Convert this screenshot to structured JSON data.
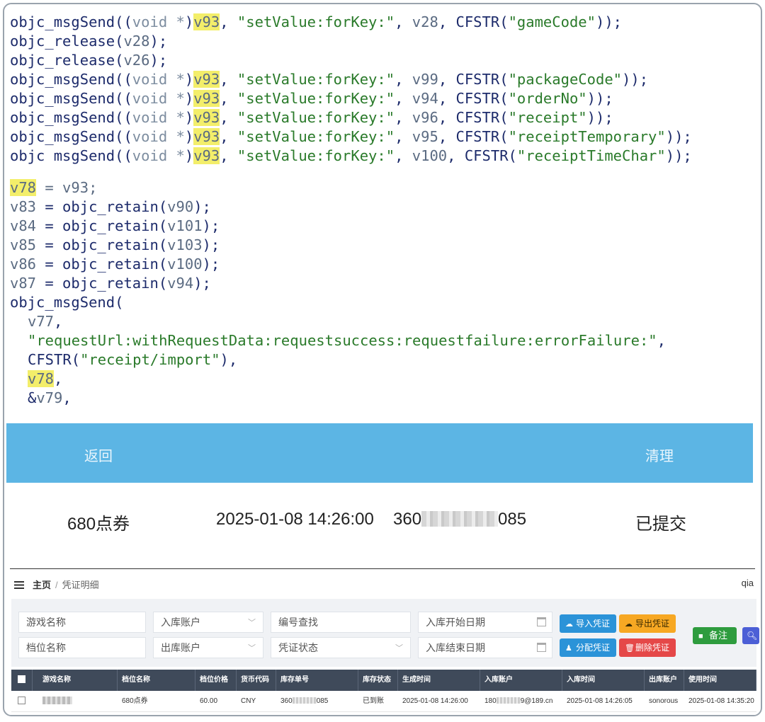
{
  "code": {
    "lines": [
      {
        "prefix": "objc_msgSend((",
        "cast": "void *",
        "mid": ")",
        "hl": "v93",
        "rest1": ", ",
        "str": "\"setValue:forKey:\"",
        "rest2": ", ",
        "var": "v28",
        "rest3": ", CFSTR(",
        "str2": "\"gameCode\"",
        "rest4": "));"
      },
      {
        "prefix": "objc_release(",
        "var": "v28",
        "rest": ");"
      },
      {
        "prefix": "objc_release(",
        "var": "v26",
        "rest": ");"
      },
      {
        "prefix": "objc_msgSend((",
        "cast": "void *",
        "mid": ")",
        "hl": "v93",
        "rest1": ", ",
        "str": "\"setValue:forKey:\"",
        "rest2": ", ",
        "var": "v99",
        "rest3": ", CFSTR(",
        "str2": "\"packageCode\"",
        "rest4": "));"
      },
      {
        "prefix": "objc_msgSend((",
        "cast": "void *",
        "mid": ")",
        "hl": "v93",
        "rest1": ", ",
        "str": "\"setValue:forKey:\"",
        "rest2": ", ",
        "var": "v94",
        "rest3": ", CFSTR(",
        "str2": "\"orderNo\"",
        "rest4": "));"
      },
      {
        "prefix": "objc_msgSend((",
        "cast": "void *",
        "mid": ")",
        "hl": "v93",
        "rest1": ", ",
        "str": "\"setValue:forKey:\"",
        "rest2": ", ",
        "var": "v96",
        "rest3": ", CFSTR(",
        "str2": "\"receipt\"",
        "rest4": "));"
      },
      {
        "prefix": "objc_msgSend((",
        "cast": "void *",
        "mid": ")",
        "hl": "v93",
        "rest1": ", ",
        "str": "\"setValue:forKey:\"",
        "rest2": ", ",
        "var": "v95",
        "rest3": ", CFSTR(",
        "str2": "\"receiptTemporary\"",
        "rest4": "));"
      },
      {
        "prefix": "objc msgSend((",
        "cast": "void *",
        "mid": ")",
        "hl": "v93",
        "rest1": ", ",
        "str": "\"setValue:forKey:\"",
        "rest2": ", ",
        "var": "v100",
        "rest3": ", CFSTR(",
        "str2": "\"receiptTimeChar\"",
        "rest4": "));"
      }
    ],
    "assign_lines": [
      {
        "hl": "v78",
        "rest": " = v93;"
      },
      {
        "var": "v83",
        "rest": " = objc_retain(",
        "arg": "v90",
        "end": ");"
      },
      {
        "var": "v84",
        "rest": " = objc_retain(",
        "arg": "v101",
        "end": ");"
      },
      {
        "var": "v85",
        "rest": " = objc_retain(",
        "arg": "v103",
        "end": ");"
      },
      {
        "var": "v86",
        "rest": " = objc_retain(",
        "arg": "v100",
        "end": ");"
      },
      {
        "var": "v87",
        "rest": " = objc_retain(",
        "arg": "v94",
        "end": ");"
      }
    ],
    "call_head": "objc_msgSend(",
    "call_arg1": "v77",
    "call_arg1_end": ",",
    "call_selector": "\"requestUrl:withRequestData:requestsuccess:requestfailure:errorFailure:\"",
    "call_selector_end": ",",
    "call_cfstr": "CFSTR(",
    "call_cfstr_str": "\"receipt/import\"",
    "call_cfstr_end": "),",
    "call_arg4": "v78",
    "call_arg4_end": ",",
    "call_arg5_amp": "&",
    "call_arg5": "v79",
    "call_arg5_end": ","
  },
  "app": {
    "back_label": "返回",
    "clean_label": "清理",
    "record": {
      "product": "680点券",
      "time": "2025-01-08 14:26:00",
      "order_prefix": "360",
      "order_suffix": "085",
      "status": "已提交"
    }
  },
  "admin": {
    "breadcrumb_home": "主页",
    "breadcrumb_sep": "/",
    "breadcrumb_current": "凭证明细",
    "user_tag": "qia",
    "filters": {
      "game_name": "游戏名称",
      "in_account": "入库账户",
      "code_search": "编号查找",
      "in_start_date": "入库开始日期",
      "tier_name": "档位名称",
      "out_account": "出库账户",
      "voucher_status": "凭证状态",
      "in_end_date": "入库结束日期"
    },
    "buttons": {
      "import": "导入凭证",
      "export": "导出凭证",
      "assign": "分配凭证",
      "delete": "删除凭证",
      "note": "备注"
    },
    "table": {
      "headers": [
        "游戏名称",
        "档位名称",
        "档位价格",
        "货币代码",
        "库存单号",
        "库存状态",
        "生成时间",
        "入库账户",
        "入库时间",
        "出库账户",
        "使用时间"
      ],
      "row": {
        "tier_name": "680点券",
        "price": "60.00",
        "currency": "CNY",
        "order_prefix": "360",
        "order_suffix": "085",
        "stock_status": "已到账",
        "created": "2025-01-08 14:26:00",
        "account_prefix": "180",
        "account_suffix": "9@189.cn",
        "in_time": "2025-01-08 14:26:05",
        "out_account": "sonorous",
        "used_time": "2025-01-08 14:35:20"
      }
    }
  }
}
